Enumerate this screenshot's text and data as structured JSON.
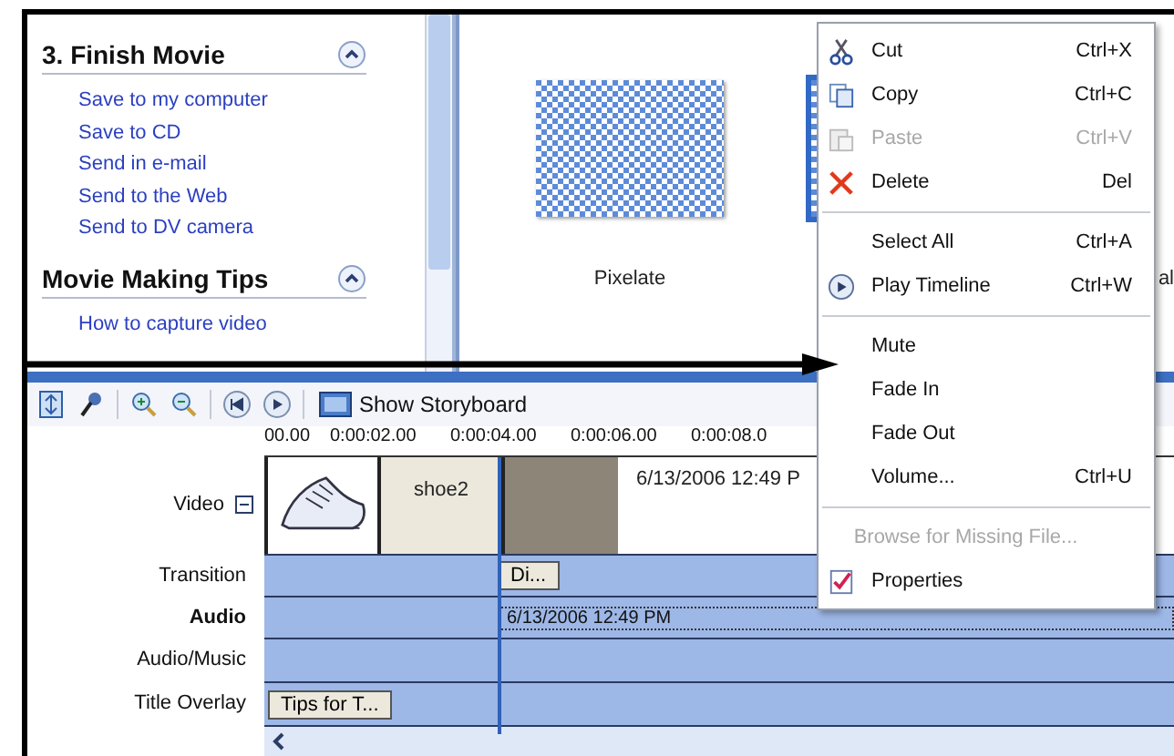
{
  "task_pane": {
    "sections": [
      {
        "title": "3. Finish Movie",
        "expanded": true,
        "links": [
          "Save to my computer",
          "Save to CD",
          "Send in e-mail",
          "Send to the Web",
          "Send to DV camera"
        ]
      },
      {
        "title": "Movie Making Tips",
        "expanded": true,
        "links": [
          "How to capture video"
        ]
      }
    ]
  },
  "effects": [
    {
      "label": "Pixelate",
      "selected": false
    },
    {
      "selected": true
    }
  ],
  "cut_off_label": "al",
  "context_menu": {
    "groups": [
      [
        {
          "label": "Cut",
          "shortcut": "Ctrl+X",
          "disabled": false
        },
        {
          "label": "Copy",
          "shortcut": "Ctrl+C",
          "disabled": false
        },
        {
          "label": "Paste",
          "shortcut": "Ctrl+V",
          "disabled": true
        },
        {
          "label": "Delete",
          "shortcut": "Del",
          "disabled": false
        }
      ],
      [
        {
          "label": "Select All",
          "shortcut": "Ctrl+A",
          "disabled": false
        },
        {
          "label": "Play Timeline",
          "shortcut": "Ctrl+W",
          "disabled": false
        }
      ],
      [
        {
          "label": "Mute",
          "disabled": false
        },
        {
          "label": "Fade In",
          "disabled": false
        },
        {
          "label": "Fade Out",
          "disabled": false
        },
        {
          "label": "Volume...",
          "shortcut": "Ctrl+U",
          "disabled": false
        }
      ],
      [
        {
          "label": "Browse for Missing File...",
          "disabled": true
        },
        {
          "label": "Properties",
          "disabled": false
        }
      ]
    ]
  },
  "toolbar": {
    "storyboard_button": "Show Storyboard"
  },
  "timeline": {
    "ruler": [
      "00.00",
      "0:00:02.00",
      "0:00:04.00",
      "0:00:06.00",
      "0:00:08.0"
    ],
    "tracks": [
      {
        "label": "Video",
        "kind": "video",
        "expanded": true
      },
      {
        "label": "Transition",
        "kind": "transition"
      },
      {
        "label": "Audio",
        "kind": "audio"
      },
      {
        "label": "Audio/Music",
        "kind": "music"
      },
      {
        "label": "Title Overlay",
        "kind": "title"
      }
    ],
    "video_clips": [
      {
        "kind": "image"
      },
      {
        "kind": "title",
        "label": "shoe2"
      },
      {
        "kind": "photo",
        "label": "6/13/2006 12:49 P"
      }
    ],
    "transition_clip": "Di...",
    "audio_clip": "6/13/2006 12:49 PM",
    "title_clip": "Tips for T..."
  }
}
